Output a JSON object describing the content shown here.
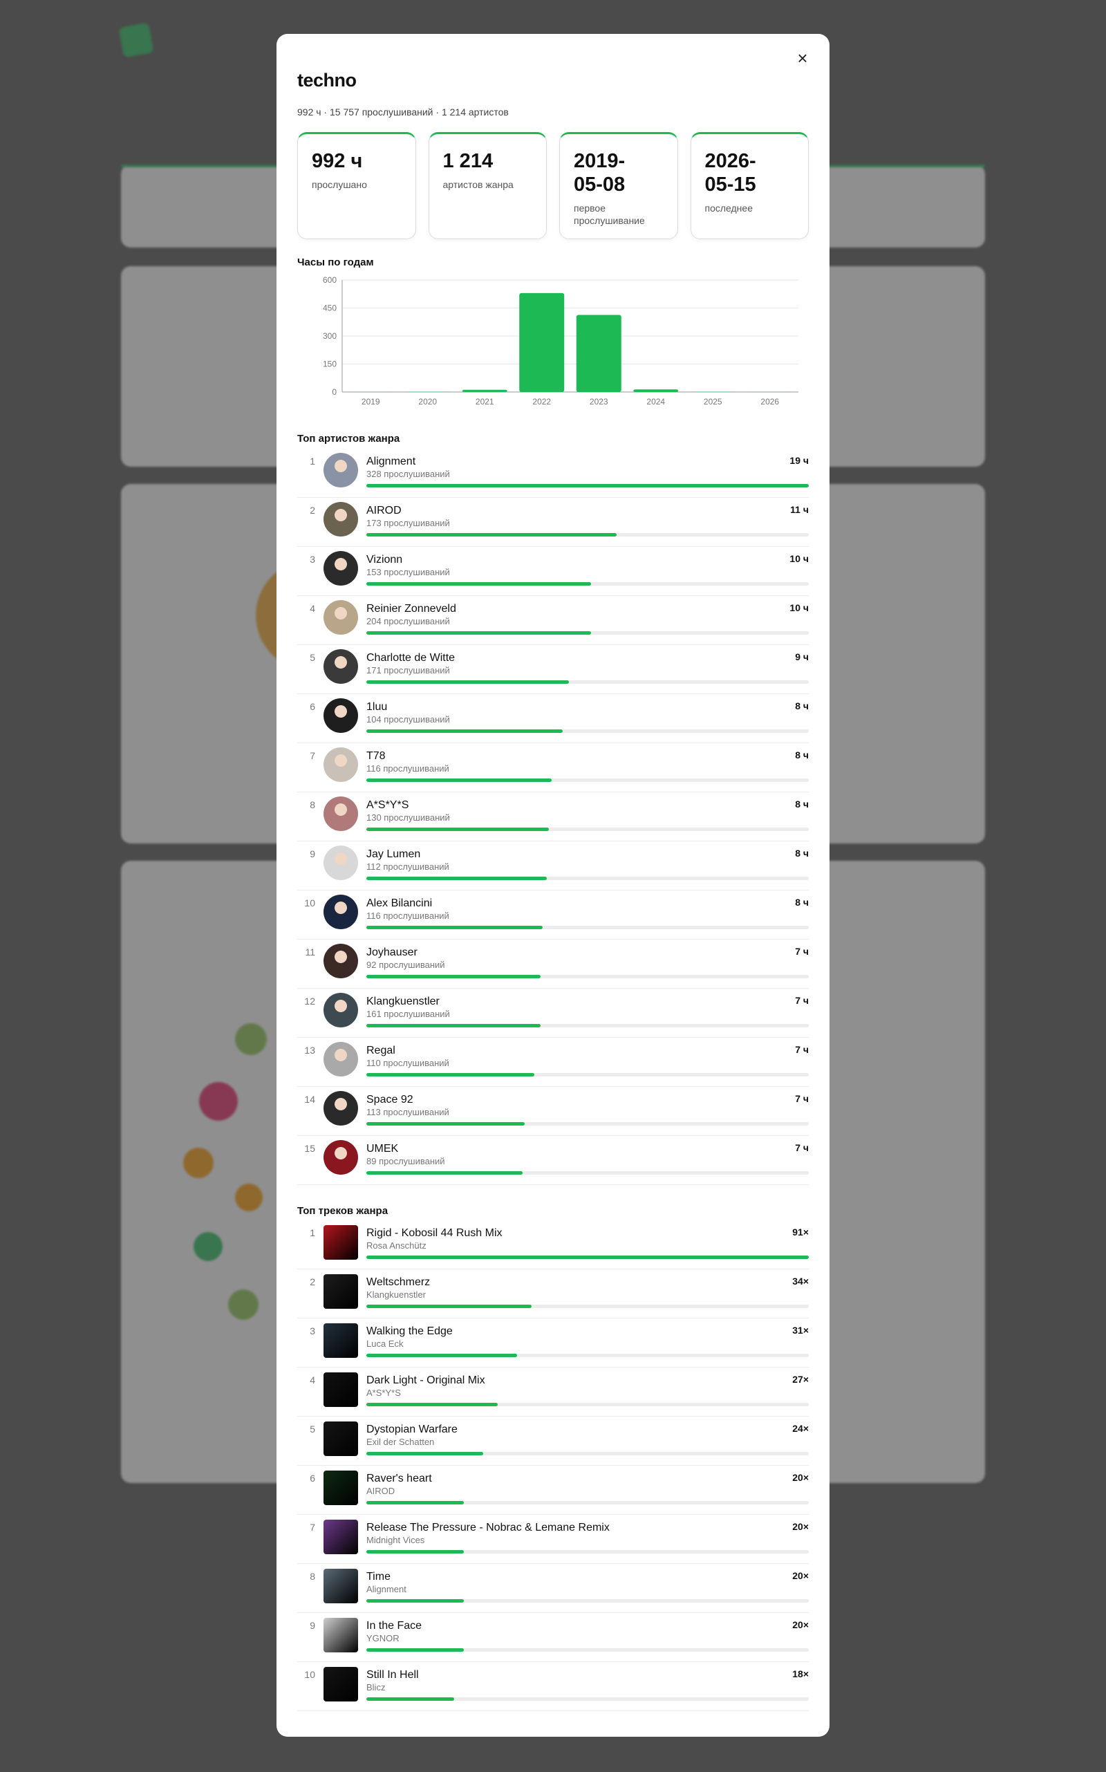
{
  "modal": {
    "title": "techno",
    "subtitle": "992 ч · 15 757 прослушиваний · 1 214 артистов",
    "close_label": "×",
    "stats": [
      {
        "value": "992 ч",
        "label": "прослушано"
      },
      {
        "value": "1 214",
        "label": "артистов жанра"
      },
      {
        "value": "2019-\n05-08",
        "label": "первое прослушивание"
      },
      {
        "value": "2026-\n05-15",
        "label": "последнее"
      }
    ],
    "hours_title": "Часы по годам",
    "artists_title": "Топ артистов жанра",
    "tracks_title": "Топ треков жанра"
  },
  "chart_data": {
    "type": "bar",
    "title": "Часы по годам",
    "categories": [
      "2019",
      "2020",
      "2021",
      "2022",
      "2023",
      "2024",
      "2025",
      "2026"
    ],
    "values": [
      0.5,
      1,
      12,
      530,
      413,
      14,
      1,
      0.5
    ],
    "ylim": [
      0,
      600
    ],
    "yticks": [
      0,
      150,
      300,
      450,
      600
    ],
    "grid": true,
    "color": "#1db954"
  },
  "top_artists": [
    {
      "rank": "1",
      "name": "Alignment",
      "plays": "328 прослушиваний",
      "hours": "19 ч",
      "share": 1.0,
      "avatar_color": "#8a93a5"
    },
    {
      "rank": "2",
      "name": "AIROD",
      "plays": "173 прослушиваний",
      "hours": "11 ч",
      "share": 0.565,
      "avatar_color": "#6b6250"
    },
    {
      "rank": "3",
      "name": "Vizionn",
      "plays": "153 прослушиваний",
      "hours": "10 ч",
      "share": 0.508,
      "avatar_color": "#2b2b2b"
    },
    {
      "rank": "4",
      "name": "Reinier Zonneveld",
      "plays": "204 прослушиваний",
      "hours": "10 ч",
      "share": 0.508,
      "avatar_color": "#b8a58a"
    },
    {
      "rank": "5",
      "name": "Charlotte de Witte",
      "plays": "171 прослушиваний",
      "hours": "9 ч",
      "share": 0.458,
      "avatar_color": "#3a3a3a"
    },
    {
      "rank": "6",
      "name": "1luu",
      "plays": "104 прослушиваний",
      "hours": "8 ч",
      "share": 0.443,
      "avatar_color": "#1e1e1e"
    },
    {
      "rank": "7",
      "name": "T78",
      "plays": "116 прослушиваний",
      "hours": "8 ч",
      "share": 0.418,
      "avatar_color": "#c9c1b8"
    },
    {
      "rank": "8",
      "name": "A*S*Y*S",
      "plays": "130 прослушиваний",
      "hours": "8 ч",
      "share": 0.413,
      "avatar_color": "#b07a7a"
    },
    {
      "rank": "9",
      "name": "Jay Lumen",
      "plays": "112 прослушиваний",
      "hours": "8 ч",
      "share": 0.408,
      "avatar_color": "#d8d8d8"
    },
    {
      "rank": "10",
      "name": "Alex Bilancini",
      "plays": "116 прослушиваний",
      "hours": "8 ч",
      "share": 0.398,
      "avatar_color": "#1a2540"
    },
    {
      "rank": "11",
      "name": "Joyhauser",
      "plays": "92 прослушиваний",
      "hours": "7 ч",
      "share": 0.393,
      "avatar_color": "#3b2a26"
    },
    {
      "rank": "12",
      "name": "Klangkuenstler",
      "plays": "161 прослушиваний",
      "hours": "7 ч",
      "share": 0.393,
      "avatar_color": "#3e4a52"
    },
    {
      "rank": "13",
      "name": "Regal",
      "plays": "110 прослушиваний",
      "hours": "7 ч",
      "share": 0.38,
      "avatar_color": "#a9a9a9"
    },
    {
      "rank": "14",
      "name": "Space 92",
      "plays": "113 прослушиваний",
      "hours": "7 ч",
      "share": 0.358,
      "avatar_color": "#2a2a2a"
    },
    {
      "rank": "15",
      "name": "UMEK",
      "plays": "89 прослушиваний",
      "hours": "7 ч",
      "share": 0.353,
      "avatar_color": "#8a1620"
    }
  ],
  "top_tracks": [
    {
      "rank": "1",
      "title": "Rigid - Kobosil 44 Rush Mix",
      "artist": "Rosa Anschütz",
      "count": "91×",
      "share": 1.0,
      "cover_color": "#b3161c"
    },
    {
      "rank": "2",
      "title": "Weltschmerz",
      "artist": "Klangkuenstler",
      "count": "34×",
      "share": 0.373,
      "cover_color": "#1d1d1d"
    },
    {
      "rank": "3",
      "title": "Walking the Edge",
      "artist": "Luca Eck",
      "count": "31×",
      "share": 0.34,
      "cover_color": "#23313d"
    },
    {
      "rank": "4",
      "title": "Dark Light - Original Mix",
      "artist": "A*S*Y*S",
      "count": "27×",
      "share": 0.297,
      "cover_color": "#111111"
    },
    {
      "rank": "5",
      "title": "Dystopian Warfare",
      "artist": "Exil der Schatten",
      "count": "24×",
      "share": 0.264,
      "cover_color": "#151515"
    },
    {
      "rank": "6",
      "title": "Raver's heart",
      "artist": "AIROD",
      "count": "20×",
      "share": 0.22,
      "cover_color": "#0f2a12"
    },
    {
      "rank": "7",
      "title": "Release The Pressure - Nobrac & Lemane Remix",
      "artist": "Midnight Vices",
      "count": "20×",
      "share": 0.22,
      "cover_color": "#6d3a8a"
    },
    {
      "rank": "8",
      "title": "Time",
      "artist": "Alignment",
      "count": "20×",
      "share": 0.22,
      "cover_color": "#5a6b78"
    },
    {
      "rank": "9",
      "title": "In the Face",
      "artist": "YGNOR",
      "count": "20×",
      "share": 0.22,
      "cover_color": "#cfcfcf"
    },
    {
      "rank": "10",
      "title": "Still In Hell",
      "artist": "Blicz",
      "count": "18×",
      "share": 0.198,
      "cover_color": "#141414"
    }
  ]
}
